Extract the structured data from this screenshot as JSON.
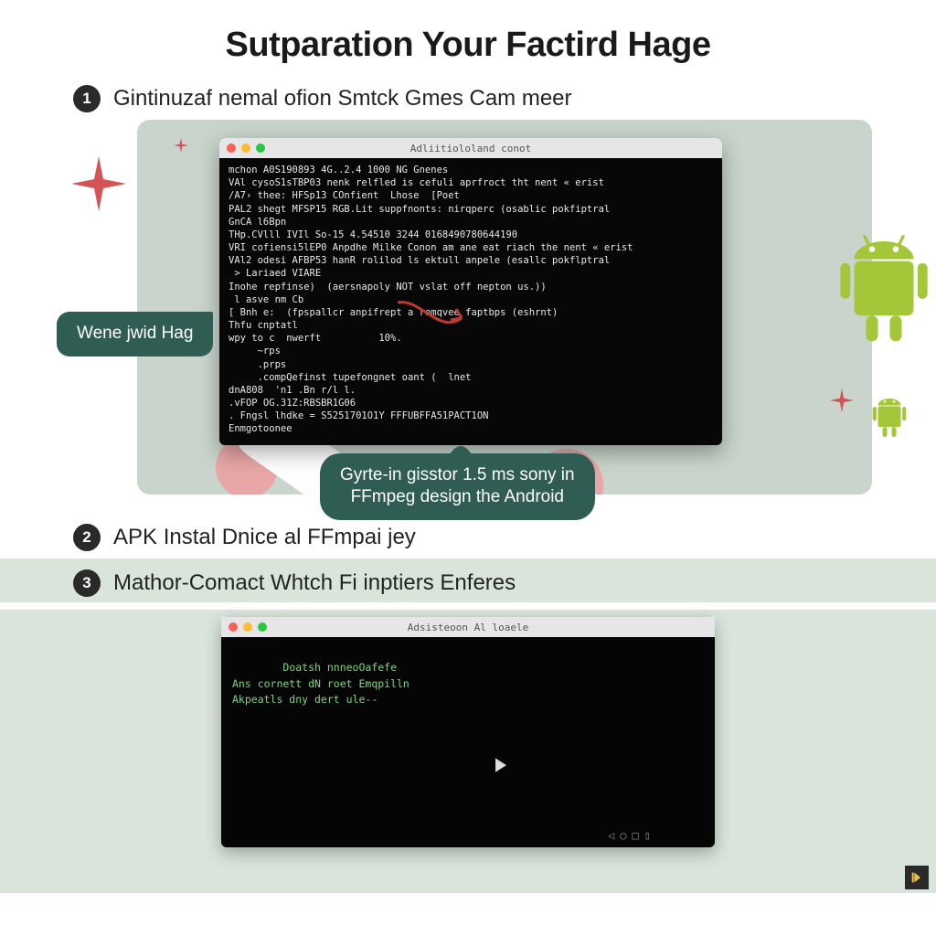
{
  "title": "Sutparation Your Factird Hage",
  "steps": {
    "s1": {
      "num": "1",
      "label": "Gintinuzaf nemal ofion Smtck Gmes Cam meer"
    },
    "s2": {
      "num": "2",
      "label": "APK Instal Dnice al FFmpai jey"
    },
    "s3": {
      "num": "3",
      "label": "Mathor-Comact Whtch Fi inptiers Enferes"
    }
  },
  "terminal1": {
    "title": "Adliitiololand conot",
    "lines": "mchon A0S190893 4G..2.4 1000 NG Gnenes\nVAl cysoS1sTBP03 nenk relfled is cefuli aprfroct tht nent « erist\n/A7› thee: HFSp13 COnfient  Lhose  [Poet\nPAL2 shegt MFSP15 RGB.Lit suppfnonts: nirqperc (osablic pokfiptral\nGnCA l6Bpn\nTHp.CVlll IVIl So-15 4.54510 3244 0168490780644190\nVRI cofiensi5lEP0 Anpdhe Milke Conon am ane eat riach the nent « erist\nVAl2 odesi AFBP53 hanR rolilod ls ektull anpele (esallc pokflptral\n > Lariaed VIARE\nInohe repfinse)  (aersnapoly NOT vslat off nepton us.))\n l asve nm Cb\n[ Bnh e:  (fpspallcr anpifrept a remqvee faptbps (eshrnt)\nThfu cnptatl\nwpy to c  nwerft          10%.\n     ~rps\n     .prps\n     .compQefinst tupefongnet oant (  lnet\ndnA808  'n1 .Bn r/l l.\n.vFOP OG.31Z:RBSBR1G06\n. Fngsl lhdke = S5251701O1Y FFFUBFFA51PACT1ON\nEnmgotoonee"
  },
  "bubbles": {
    "left": "Wene jwid Hag",
    "bottom_line1": "Gyrte-in gisstor 1.5 ms sony in",
    "bottom_line2": "FFmpeg design the Android"
  },
  "terminal3": {
    "title": "Adsisteoon Al loaele",
    "lines": "Doatsh nnneoOafefe\nAns cornett dN roet Emqpilln\nAkpeatls dny dert ule-- "
  },
  "colors": {
    "accent_green": "#2f5c53",
    "panel_bg": "#c9d5cc",
    "panel3_bg": "#d9e5da",
    "android": "#a4c639"
  }
}
